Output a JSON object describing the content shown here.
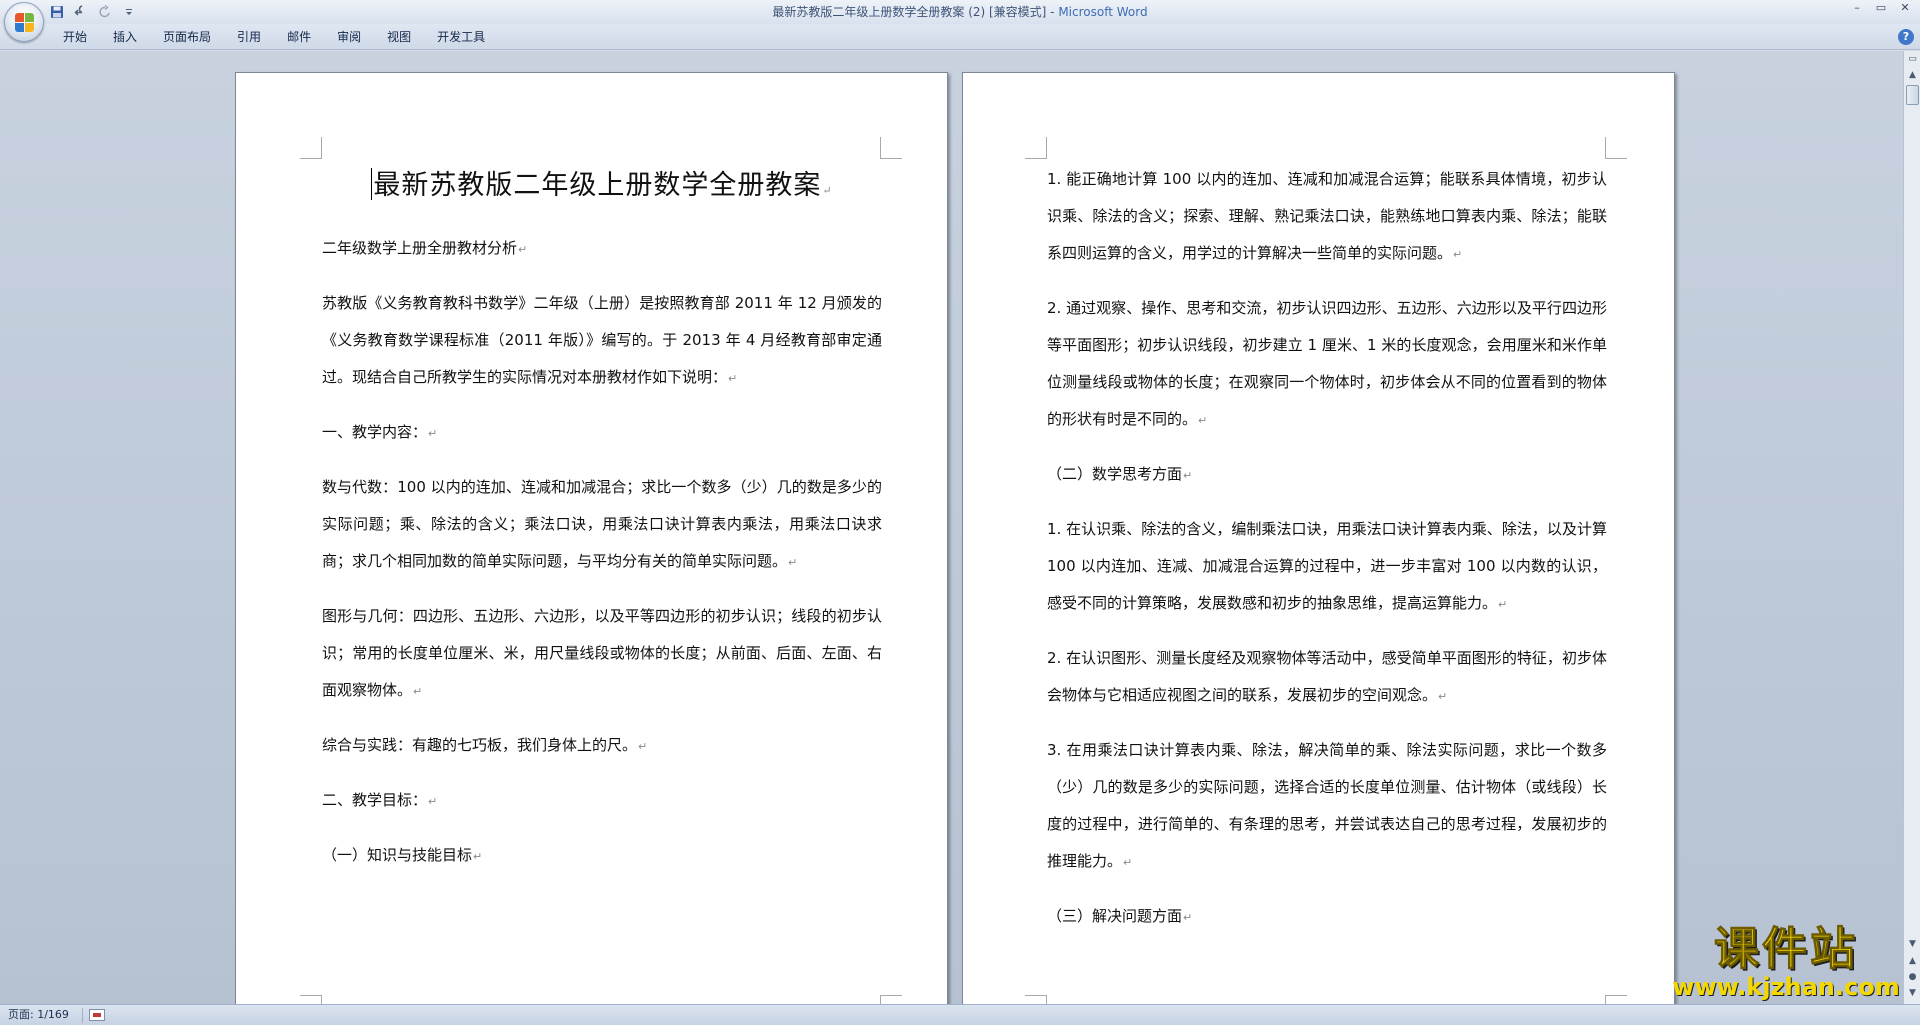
{
  "window": {
    "title": "最新苏教版二年级上册数学全册教案 (2) [兼容模式] - ",
    "app_name": "Microsoft Word",
    "controls": [
      "–",
      "▭",
      "✕"
    ]
  },
  "quick_access": {
    "icons": [
      "save-icon",
      "undo-icon",
      "redo-icon",
      "customize-icon"
    ]
  },
  "ribbon": {
    "tabs": [
      "开始",
      "插入",
      "页面布局",
      "引用",
      "邮件",
      "审阅",
      "视图",
      "开发工具"
    ],
    "help": "?"
  },
  "document": {
    "title": "最新苏教版二年级上册数学全册教案",
    "pilcrow": "↵",
    "left_paragraphs": [
      "二年级数学上册全册教材分析",
      "苏教版《义务教育教科书数学》二年级（上册）是按照教育部 2011 年 12 月颁发的《义务教育数学课程标准（2011 年版）》编写的。于 2013 年 4 月经教育部审定通过。现结合自己所教学生的实际情况对本册教材作如下说明：",
      "一、教学内容：",
      "数与代数：100 以内的连加、连减和加减混合；求比一个数多（少）几的数是多少的实际问题；乘、除法的含义；乘法口诀，用乘法口诀计算表内乘法，用乘法口诀求商；求几个相同加数的简单实际问题，与平均分有关的简单实际问题。",
      "图形与几何：四边形、五边形、六边形，以及平等四边形的初步认识；线段的初步认识；常用的长度单位厘米、米，用尺量线段或物体的长度；从前面、后面、左面、右面观察物体。",
      "综合与实践：有趣的七巧板，我们身体上的尺。",
      "二、教学目标：",
      "（一）知识与技能目标"
    ],
    "right_paragraphs": [
      "1. 能正确地计算 100 以内的连加、连减和加减混合运算；能联系具体情境，初步认识乘、除法的含义；探索、理解、熟记乘法口诀，能熟练地口算表内乘、除法；能联系四则运算的含义，用学过的计算解决一些简单的实际问题。",
      "2. 通过观察、操作、思考和交流，初步认识四边形、五边形、六边形以及平行四边形等平面图形；初步认识线段，初步建立 1 厘米、1 米的长度观念，会用厘米和米作单位测量线段或物体的长度；在观察同一个物体时，初步体会从不同的位置看到的物体的形状有时是不同的。",
      "（二）数学思考方面",
      "1. 在认识乘、除法的含义，编制乘法口诀，用乘法口诀计算表内乘、除法，以及计算 100 以内连加、连减、加减混合运算的过程中，进一步丰富对 100 以内数的认识，感受不同的计算策略，发展数感和初步的抽象思维，提高运算能力。",
      "2. 在认识图形、测量长度经及观察物体等活动中，感受简单平面图形的特征，初步体会物体与它相适应视图之间的联系，发展初步的空间观念。",
      "3. 在用乘法口诀计算表内乘、除法，解决简单的乘、除法实际问题，求比一个数多（少）几的数是多少的实际问题，选择合适的长度单位测量、估计物体（或线段）长度的过程中，进行简单的、有条理的思考，并尝试表达自己的思考过程，发展初步的推理能力。",
      "（三）解决问题方面"
    ]
  },
  "statusbar": {
    "page_info": "页面: 1/169"
  },
  "watermark": {
    "text": "课件站",
    "url": "www.kjzhan.com"
  }
}
